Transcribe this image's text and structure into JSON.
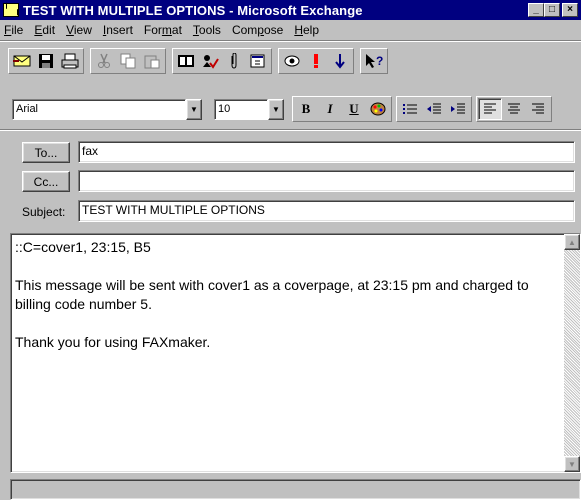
{
  "window": {
    "title": "TEST WITH MULTIPLE OPTIONS - Microsoft Exchange",
    "minimize_glyph": "_",
    "maximize_glyph": "□",
    "close_glyph": "×"
  },
  "menu": [
    {
      "label": "File",
      "key": "F"
    },
    {
      "label": "Edit",
      "key": "E"
    },
    {
      "label": "View",
      "key": "V"
    },
    {
      "label": "Insert",
      "key": "I"
    },
    {
      "label": "Format",
      "key": "m"
    },
    {
      "label": "Tools",
      "key": "T"
    },
    {
      "label": "Compose",
      "key": "p"
    },
    {
      "label": "Help",
      "key": "H"
    }
  ],
  "format": {
    "font_name": "Arial",
    "font_size": "10",
    "bold": "B",
    "italic": "I",
    "underline": "U"
  },
  "address": {
    "to_label": "To...",
    "cc_label": "Cc...",
    "subject_label": "Subject:",
    "to_value": "fax",
    "cc_value": "",
    "subject_value": "TEST WITH MULTIPLE OPTIONS"
  },
  "message": {
    "body": "::C=cover1, 23:15, B5\n\nThis message will be sent with cover1 as a coverpage, at 23:15 pm and charged to billing code number 5.\n\nThank you for using FAXmaker."
  },
  "icons": {
    "send": "send-icon",
    "save": "save-icon",
    "print": "print-icon",
    "cut": "cut-icon",
    "copy": "copy-icon",
    "paste": "paste-icon",
    "address_book": "address-book-icon",
    "check_names": "check-names-icon",
    "insert_file": "paperclip-icon",
    "properties": "properties-icon",
    "read_receipt": "read-receipt-icon",
    "importance_high": "importance-high-icon",
    "importance_low": "importance-low-icon",
    "help": "help-pointer-icon",
    "color": "color-palette-icon",
    "bullets": "bullets-icon",
    "decrease_indent": "decrease-indent-icon",
    "increase_indent": "increase-indent-icon",
    "align_left": "align-left-icon",
    "align_center": "align-center-icon",
    "align_right": "align-right-icon"
  }
}
